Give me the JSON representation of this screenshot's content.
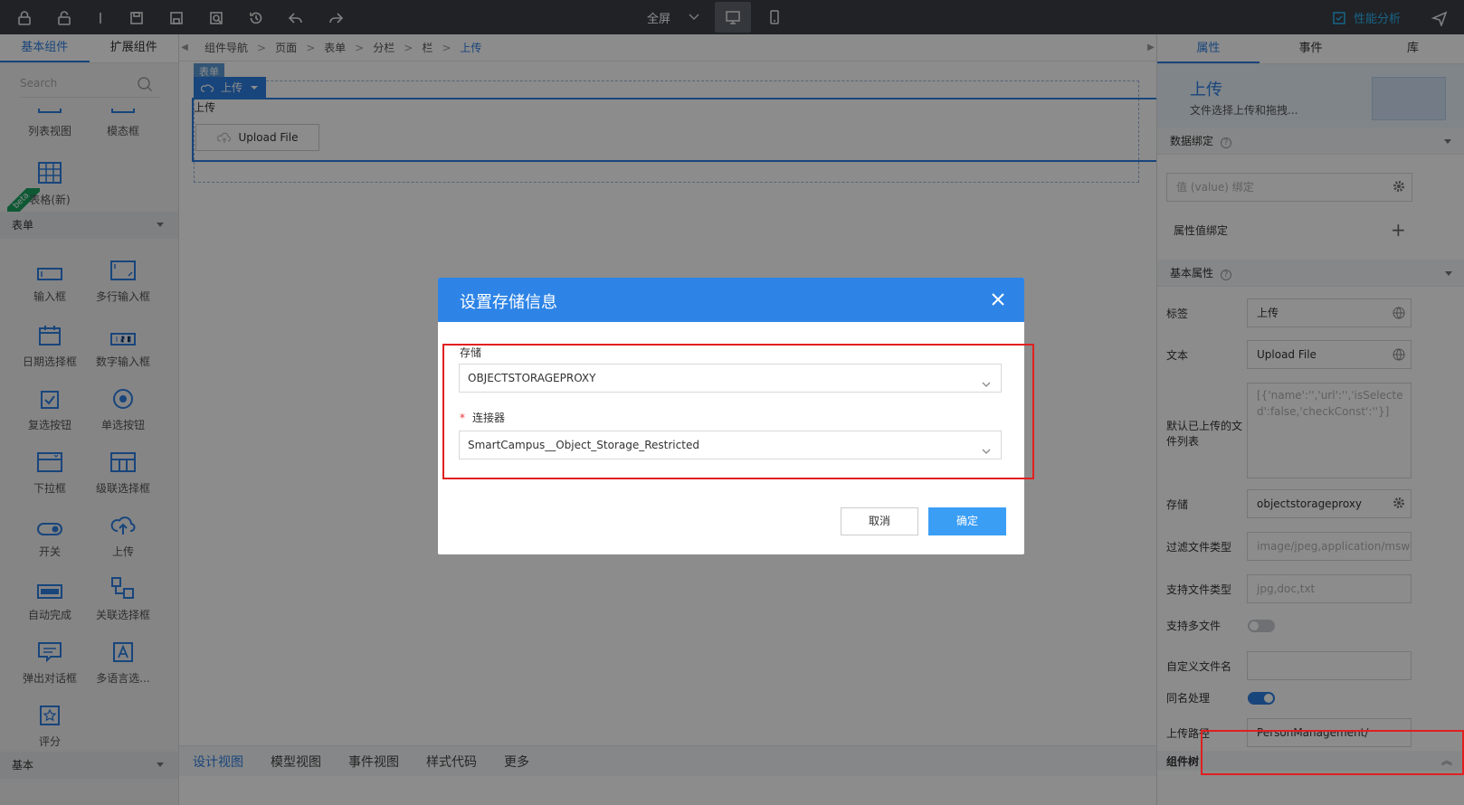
{
  "toolbar": {
    "fullscreen_label": "全屏",
    "perf_label": "性能分析",
    "icons": [
      "lock-icon",
      "unlock-icon",
      "cursor-icon",
      "save-icon",
      "save-as-icon",
      "preview-icon",
      "history-icon",
      "undo-icon",
      "redo-icon",
      "desktop-icon",
      "mobile-icon",
      "performance-icon",
      "publish-icon"
    ]
  },
  "left_panel": {
    "tabs": [
      "基本组件",
      "扩展组件"
    ],
    "search_placeholder": "Search",
    "top_items": [
      {
        "label": "列表视图",
        "icon": "list-view-icon"
      },
      {
        "label": "模态框",
        "icon": "modal-icon"
      },
      {
        "label": "表格(新)",
        "icon": "table-icon",
        "badge": "beta"
      }
    ],
    "form_section": "表单",
    "form_items": [
      {
        "label": "输入框",
        "icon": "input-icon"
      },
      {
        "label": "多行输入框",
        "icon": "textarea-icon"
      },
      {
        "label": "日期选择框",
        "icon": "date-icon"
      },
      {
        "label": "数字输入框",
        "icon": "number-icon"
      },
      {
        "label": "复选按钮",
        "icon": "checkbox-icon"
      },
      {
        "label": "单选按钮",
        "icon": "radio-icon"
      },
      {
        "label": "下拉框",
        "icon": "dropdown-icon"
      },
      {
        "label": "级联选择框",
        "icon": "cascade-icon"
      },
      {
        "label": "开关",
        "icon": "switch-icon"
      },
      {
        "label": "上传",
        "icon": "upload-icon"
      },
      {
        "label": "自动完成",
        "icon": "autocomplete-icon"
      },
      {
        "label": "关联选择框",
        "icon": "relation-icon"
      },
      {
        "label": "弹出对话框",
        "icon": "dialog-icon"
      },
      {
        "label": "多语言选...",
        "icon": "multilang-icon"
      },
      {
        "label": "评分",
        "icon": "rating-icon"
      }
    ],
    "basic_section": "基本"
  },
  "breadcrumb": [
    "组件导航",
    "页面",
    "表单",
    "分栏",
    "栏",
    "上传"
  ],
  "canvas": {
    "form_tag": "表单",
    "upload_tag": "上传",
    "upload_label": "上传",
    "upload_button": "Upload File"
  },
  "bottom_tabs": [
    "设计视图",
    "模型视图",
    "事件视图",
    "样式代码",
    "更多"
  ],
  "right_panel": {
    "tabs": [
      "属性",
      "事件",
      "库"
    ],
    "hero_title": "上传",
    "hero_desc": "文件选择上传和拖拽...",
    "data_binding": "数据绑定",
    "value_binding_placeholder": "值 (value) 绑定",
    "attr_binding": "属性值绑定",
    "basic_props": "基本属性",
    "fields": {
      "label": {
        "name": "标签",
        "value": "上传"
      },
      "text": {
        "name": "文本",
        "value": "Upload File"
      },
      "default_list": {
        "name": "默认已上传的文件列表",
        "placeholder": "[{'name':'','url':'','isSelected':false,'checkConst':''}]"
      },
      "storage": {
        "name": "存储",
        "value": "objectstorageproxy"
      },
      "filter_types": {
        "name": "过滤文件类型",
        "placeholder": "image/jpeg,application/msword"
      },
      "support_types": {
        "name": "支持文件类型",
        "placeholder": "jpg,doc,txt"
      },
      "multi": {
        "name": "支持多文件",
        "on": false
      },
      "custom_name": {
        "name": "自定义文件名",
        "value": ""
      },
      "same_name": {
        "name": "同名处理",
        "on": true
      },
      "upload_path": {
        "name": "上传路径",
        "value": "PersonManagement/"
      }
    },
    "component_tree": "组件树"
  },
  "modal": {
    "title": "设置存储信息",
    "storage_label": "存储",
    "storage_value": "OBJECTSTORAGEPROXY",
    "connector_label": "连接器",
    "connector_value": "SmartCampus__Object_Storage_Restricted",
    "cancel": "取消",
    "ok": "确定"
  },
  "colors": {
    "accent": "#2d7ee1",
    "highlight": "#e02020",
    "toolbar": "#3b3f46"
  }
}
